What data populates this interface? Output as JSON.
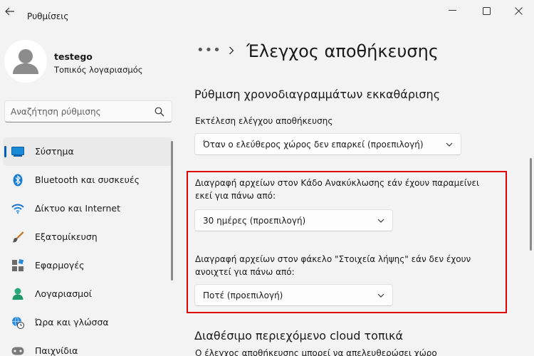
{
  "app": {
    "title": "Ρυθμίσεις"
  },
  "colors": {
    "accent": "#005fb8",
    "highlight": "#e00000"
  },
  "profile": {
    "name": "testego",
    "account_type": "Τοπικός λογαριασμός"
  },
  "search": {
    "placeholder": "Αναζήτηση ρύθμισης",
    "icon": "search-icon"
  },
  "sidebar": {
    "items": [
      {
        "label": "Σύστημα",
        "icon": "system-display-icon",
        "active": true
      },
      {
        "label": "Bluetooth και συσκευές",
        "icon": "bluetooth-icon"
      },
      {
        "label": "Δίκτυο και Internet",
        "icon": "wifi-icon"
      },
      {
        "label": "Εξατομίκευση",
        "icon": "brush-icon"
      },
      {
        "label": "Εφαρμογές",
        "icon": "apps-icon"
      },
      {
        "label": "Λογαριασμοί",
        "icon": "account-icon"
      },
      {
        "label": "Ώρα και γλώσσα",
        "icon": "globe-clock-icon"
      },
      {
        "label": "Παιχνίδια",
        "icon": "gamepad-icon"
      }
    ]
  },
  "main": {
    "breadcrumb_more": "•••",
    "title": "Έλεγχος αποθήκευσης",
    "schedule_section": "Ρύθμιση χρονοδιαγραμμάτων εκκαθάρισης",
    "run_label": "Εκτέλεση ελέγχου αποθήκευσης",
    "run_value": "Όταν ο ελεύθερος χώρος δεν επαρκεί (προεπιλογή)",
    "recycle_label_1": "Διαγραφή αρχείων στον Κάδο Ανακύκλωσης εάν έχουν παραμείνει",
    "recycle_label_2": "εκεί για πάνω από:",
    "recycle_value": "30 ημέρες (προεπιλογή)",
    "downloads_label_1": "Διαγραφή αρχείων στον φάκελο \"Στοιχεία λήψης\" εάν δεν έχουν",
    "downloads_label_2": "ανοιχτεί για πάνω από:",
    "downloads_value": "Ποτέ (προεπιλογή)",
    "cloud_section": "Διαθέσιμο περιεχόμενο cloud τοπικά",
    "cloud_desc": "Ο έλεγχος αποθήκευσης μπορεί να απελευθερώσει χώρο"
  }
}
